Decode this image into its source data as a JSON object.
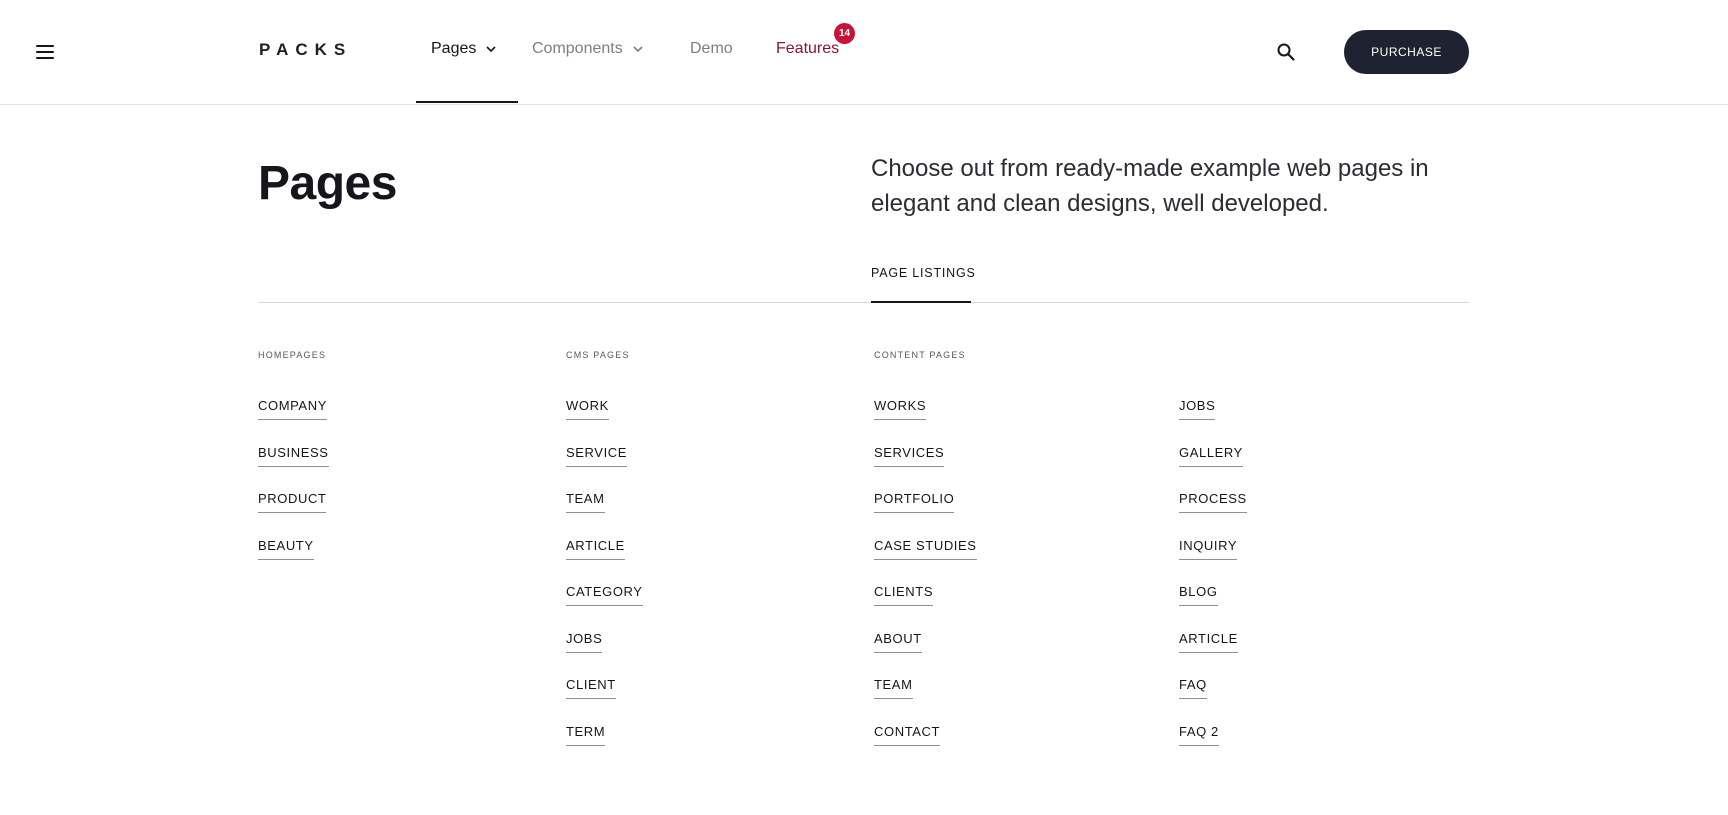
{
  "header": {
    "logo": "PACKS",
    "nav": [
      {
        "label": "Pages"
      },
      {
        "label": "Components"
      },
      {
        "label": "Demo"
      },
      {
        "label": "Features",
        "badge": "14"
      }
    ],
    "purchase_label": "PURCHASE",
    "icons": {
      "menu": "hamburger-menu-icon",
      "search": "search-icon",
      "chevron": "chevron-down-icon"
    }
  },
  "main": {
    "title": "Pages",
    "description": "Choose out from ready-made example web pages in elegant and clean designs, well developed.",
    "tab": "PAGE LISTINGS"
  },
  "columns": [
    {
      "heading": "HOMEPAGES",
      "links": [
        "COMPANY",
        "BUSINESS",
        "PRODUCT",
        "BEAUTY"
      ]
    },
    {
      "heading": "CMS PAGES",
      "links": [
        "WORK",
        "SERVICE",
        "TEAM",
        "ARTICLE",
        "CATEGORY",
        "JOBS",
        "CLIENT",
        "TERM"
      ]
    },
    {
      "heading": "CONTENT PAGES",
      "links": [
        "WORKS",
        "SERVICES",
        "PORTFOLIO",
        "CASE STUDIES",
        "CLIENTS",
        "ABOUT",
        "TEAM",
        "CONTACT"
      ]
    },
    {
      "heading": "",
      "links": [
        "JOBS",
        "GALLERY",
        "PROCESS",
        "INQUIRY",
        "BLOG",
        "ARTICLE",
        "FAQ",
        "FAQ 2"
      ]
    }
  ],
  "colors": {
    "accent": "#8a1634",
    "badge": "#c7143d",
    "button": "#1f2230"
  }
}
